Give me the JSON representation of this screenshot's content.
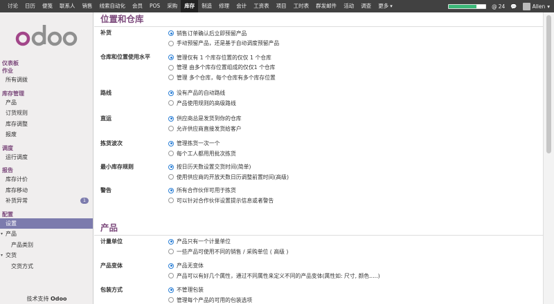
{
  "topbar": {
    "nav": [
      "讨论",
      "日历",
      "便笺",
      "联系人",
      "销售",
      "线索自动化",
      "会员",
      "POS",
      "采购",
      "库存",
      "制造",
      "修理",
      "会计",
      "工资表",
      "项目",
      "工时表",
      "群发邮件",
      "活动",
      "调查",
      "更多"
    ],
    "active_index": 9,
    "more_caret": "▾",
    "progress": 0.75,
    "chat_count": "24",
    "user_name": "Allen",
    "user_caret": "▾"
  },
  "sidebar": {
    "logo_text": "odoo",
    "powered_prefix": "技术支持",
    "powered_brand": "Odoo",
    "sections": [
      {
        "title": "仪表板",
        "items": []
      },
      {
        "title": "作业",
        "items": [
          {
            "label": "所有调拨"
          }
        ]
      },
      {
        "title": "库存管理",
        "items": [
          {
            "label": "产品"
          },
          {
            "label": "订货规则"
          },
          {
            "label": "库存调整"
          },
          {
            "label": "报废"
          }
        ]
      },
      {
        "title": "调度",
        "items": [
          {
            "label": "运行调度"
          }
        ]
      },
      {
        "title": "报告",
        "items": [
          {
            "label": "库存计价"
          },
          {
            "label": "库存移动"
          },
          {
            "label": "补货异常",
            "badge": "1"
          }
        ]
      },
      {
        "title": "配置",
        "items": [
          {
            "label": "设置",
            "active": true
          },
          {
            "label": "产品",
            "caret": "▾"
          },
          {
            "label": "产品类别",
            "sub": true
          },
          {
            "label": "交货",
            "caret": "▾"
          },
          {
            "label": "交货方式",
            "sub": true
          }
        ]
      }
    ]
  },
  "main": {
    "section1_title": "位置和仓库",
    "section2_title": "产品",
    "settings1": [
      {
        "label": "补货",
        "options": [
          {
            "text": "销售订单确认后立即预留产品",
            "on": true
          },
          {
            "text": "手动预留产品，还是基于自动调度预留产品",
            "on": false
          }
        ]
      },
      {
        "label": "仓库和位置使用水平",
        "options": [
          {
            "text": "管理仅有 1 个库存位置的仅仅 1 个仓库",
            "on": true
          },
          {
            "text": "管理 由多个库存位置组成的仅仅1 个仓库",
            "on": false
          },
          {
            "text": "管理 多个仓库，每个仓库有多个库存位置",
            "on": false
          }
        ]
      },
      {
        "label": "路线",
        "options": [
          {
            "text": "没有产品的自动路线",
            "on": true
          },
          {
            "text": "产品使用规则的高级路线",
            "on": false
          }
        ]
      },
      {
        "label": "直运",
        "options": [
          {
            "text": "供应商总是发货到你的仓库",
            "on": true
          },
          {
            "text": "允许供应商直接发货给客户",
            "on": false
          }
        ]
      },
      {
        "label": "拣货波次",
        "options": [
          {
            "text": "管理拣货一次一个",
            "on": true
          },
          {
            "text": "每个工人都用用批次拣货",
            "on": false
          }
        ]
      },
      {
        "label": "最小库存规则",
        "options": [
          {
            "text": "按日历天数设置交货时间(简单)",
            "on": true
          },
          {
            "text": "使用供应商的开放天数日历调整前置时间(高级)",
            "on": false
          }
        ]
      },
      {
        "label": "警告",
        "options": [
          {
            "text": "所有合作伙伴可用于拣货",
            "on": true
          },
          {
            "text": "可以针对合作伙伴设置提示信息或者警告",
            "on": false
          }
        ]
      }
    ],
    "settings2": [
      {
        "label": "计量单位",
        "options": [
          {
            "text": "产品只有一个计量单位",
            "on": true
          },
          {
            "text": "一些产品可使用不同的销售 / 采购单位 ( 高级 )",
            "on": false
          }
        ]
      },
      {
        "label": "产品变体",
        "options": [
          {
            "text": "产品无变体",
            "on": true
          },
          {
            "text": "产品可以有好几个属性，通过不同属性来定义不同的产品变体(属性如: 尺寸, 颜色.....)",
            "on": false
          }
        ]
      },
      {
        "label": "包装方式",
        "options": [
          {
            "text": "不管理包装",
            "on": true
          },
          {
            "text": "管理每个产品的可用的包装选项",
            "on": false
          }
        ]
      }
    ]
  }
}
